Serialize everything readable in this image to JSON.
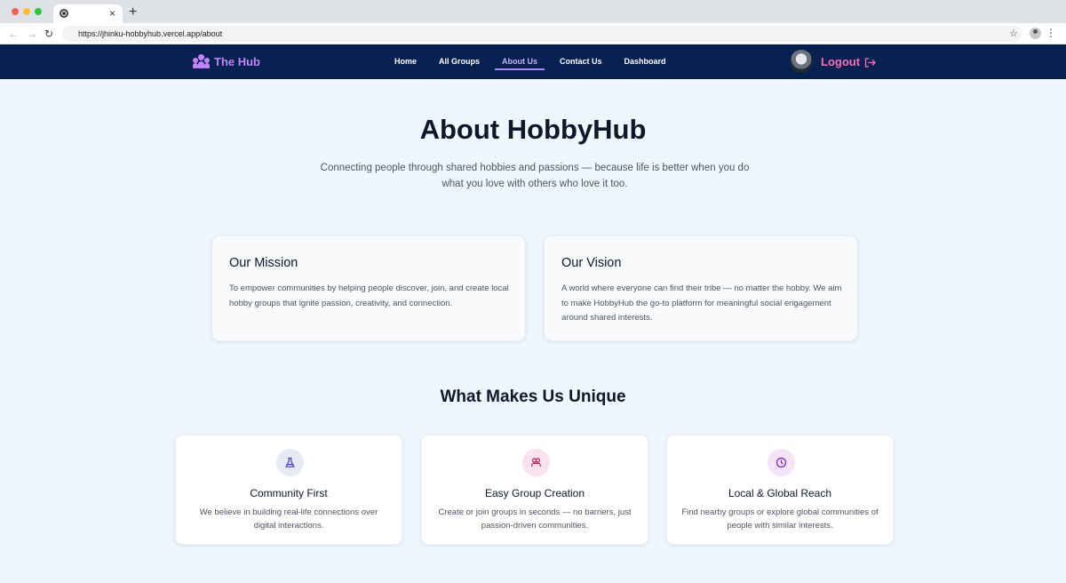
{
  "browser": {
    "tab_close": "×",
    "new_tab": "+",
    "url": "https://jhinku-hobbyhub.vercel.app/about"
  },
  "nav": {
    "logo_text": "The Hub",
    "items": [
      {
        "label": "Home",
        "active": false
      },
      {
        "label": "All Groups",
        "active": false
      },
      {
        "label": "About Us",
        "active": true
      },
      {
        "label": "Contact Us",
        "active": false
      },
      {
        "label": "Dashboard",
        "active": false
      }
    ],
    "logout_label": "Logout"
  },
  "hero": {
    "title": "About HobbyHub",
    "subtitle": "Connecting people through shared hobbies and passions — because life is better when you do what you love with others who love it too."
  },
  "mission": {
    "title": "Our Mission",
    "text": "To empower communities by helping people discover, join, and create local hobby groups that ignite passion, creativity, and connection."
  },
  "vision": {
    "title": "Our Vision",
    "text": "A world where everyone can find their tribe — no matter the hobby. We aim to make HobbyHub the go-to platform for meaningful social engagement around shared interests."
  },
  "unique": {
    "title": "What Makes Us Unique",
    "features": [
      {
        "icon": "flask-icon",
        "title": "Community First",
        "text": "We believe in building real-life connections over digital interactions."
      },
      {
        "icon": "users-icon",
        "title": "Easy Group Creation",
        "text": "Create or join groups in seconds — no barriers, just passion-driven communities."
      },
      {
        "icon": "clock-icon",
        "title": "Local & Global Reach",
        "text": "Find nearby groups or explore global communities of people with similar interests."
      }
    ]
  },
  "colors": {
    "nav_bg": "#06214f",
    "accent_purple": "#c084fc",
    "logout_pink": "#f472b6",
    "page_bg": "#eff6fd"
  }
}
